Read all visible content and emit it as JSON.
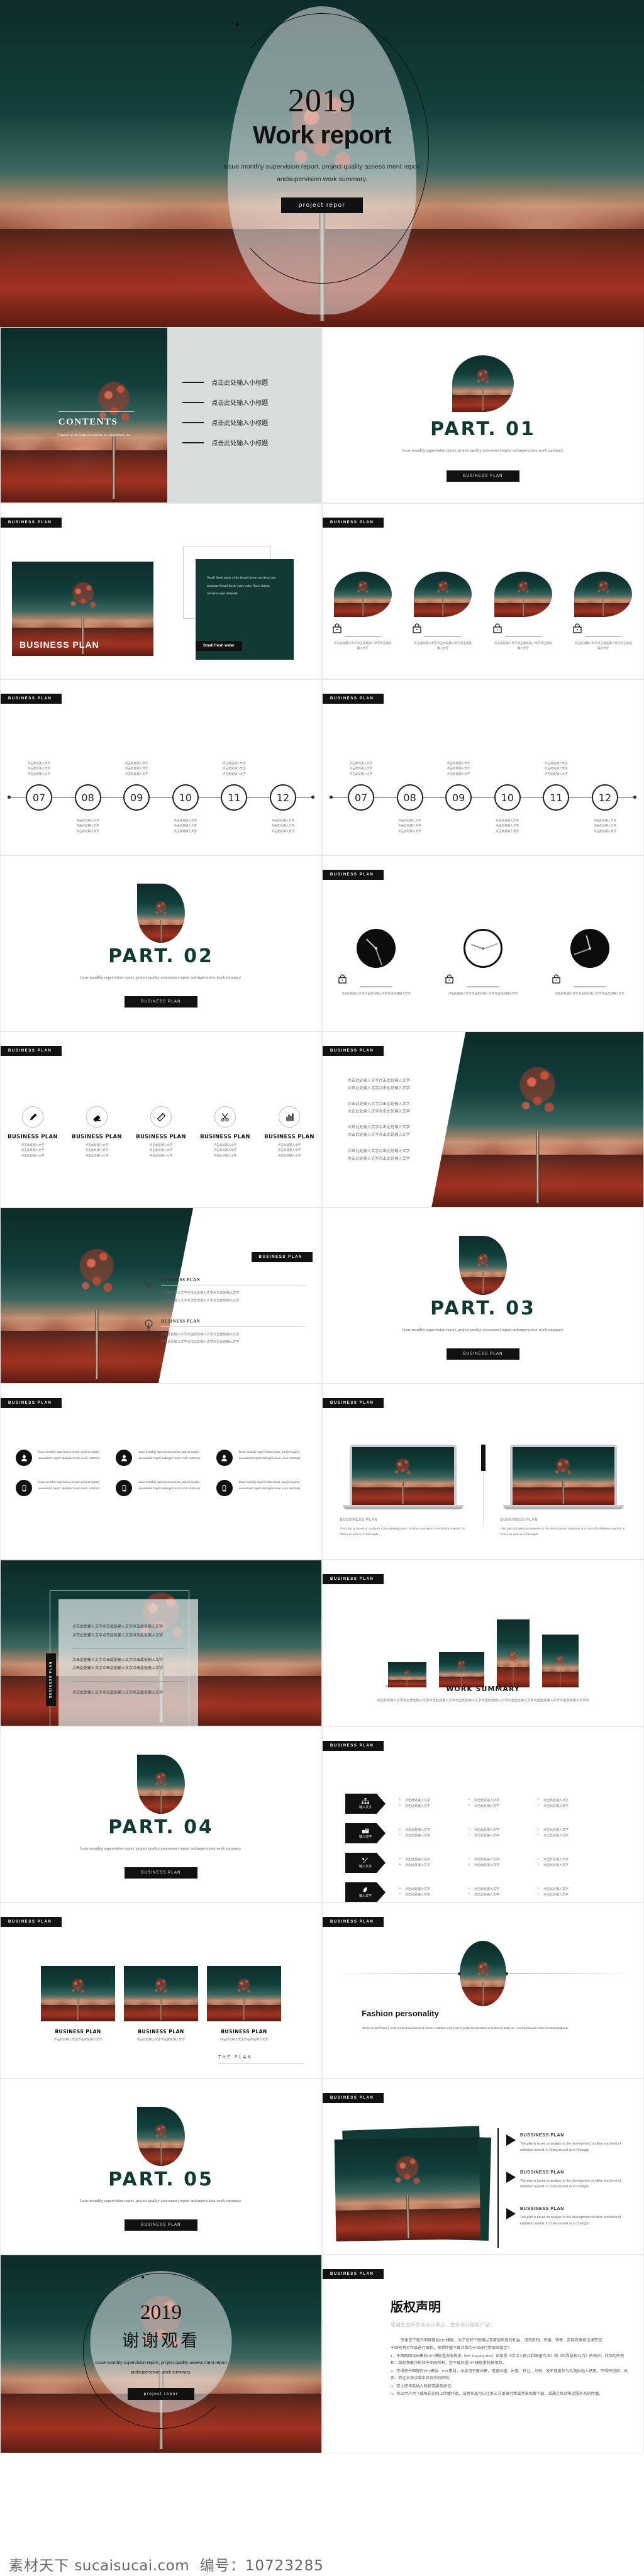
{
  "cover": {
    "year": "2019",
    "title": "Work report",
    "subtitle": "Issue monthly supervision report, project quality assess ment report andsupervision work summary.",
    "button": "project repor"
  },
  "tag": {
    "business_plan": "BUSINESS PLAN",
    "bussiness_plan": "BUSSINESS PLAN"
  },
  "contents": {
    "heading": "CONTENTS",
    "subtitle": "Reports of the work of a society or learned body etc.",
    "items": [
      "点击此处输入小标题",
      "点击此处输入小标题",
      "点击此处输入小标题",
      "点击此处输入小标题"
    ]
  },
  "parts": [
    {
      "title": "PART. 01",
      "sub": "Issue monthly supervision report, project quality assessment report andsupervision work summary.",
      "button": "BUSINESS PLAN"
    },
    {
      "title": "PART. 02",
      "sub": "Issue monthly supervision report, project quality assessment report andsupervision work summary.",
      "button": "BUSINESS PLAN"
    },
    {
      "title": "PART. 03",
      "sub": "Issue monthly supervision report, project quality assessment report andsupervision work summary.",
      "button": "BUSINESS PLAN"
    },
    {
      "title": "PART. 04",
      "sub": "Issue monthly supervision report, project quality assessment report andsupervision work summary.",
      "button": "BUSINESS PLAN"
    },
    {
      "title": "PART. 05",
      "sub": "Issue monthly supervision report, project quality assessment report andsupervision work summary.",
      "button": "BUSINESS PLAN"
    }
  ],
  "business_card": {
    "image_caption": "BUSINESS PLAN",
    "body": "Small fresh water color floral theme universal ppt template.Small fresh water color floral theme universal ppt template",
    "button": "Small fresh water"
  },
  "leaf_cards": {
    "caption": "点击此处输入文字点击此处输入文字点击此处输入文字",
    "count": 4
  },
  "timeline": {
    "nodes": [
      "07",
      "08",
      "09",
      "10",
      "11",
      "12"
    ],
    "caption": "点击此处输入文字\n点击此处输入文字\n点击此处输入文字"
  },
  "clocks": {
    "caption": "点击此处输入文字点击此处输入文字点击此处输入文字",
    "items": [
      {
        "style": "dark",
        "hour": 225,
        "minute": 70
      },
      {
        "style": "light",
        "hour": 200,
        "minute": 340
      },
      {
        "style": "dark",
        "hour": 255,
        "minute": 160
      }
    ]
  },
  "tools": {
    "items": [
      {
        "icon": "pencil-icon",
        "title": "BUSINESS PLAN"
      },
      {
        "icon": "eraser-icon",
        "title": "BUSINESS PLAN"
      },
      {
        "icon": "ruler-icon",
        "title": "BUSINESS PLAN"
      },
      {
        "icon": "scissors-icon",
        "title": "BUSINESS PLAN"
      },
      {
        "icon": "bar-chart-icon",
        "title": "BUSINESS PLAN"
      }
    ],
    "caption": "点击此处输入文字\n点击此处输入文字\n点击此处输入文字"
  },
  "diagonal_text": {
    "line": "点击此处输入文字点击此处输入文字\n点击此处输入文字点击此处输入文字"
  },
  "bulbs": {
    "items": [
      {
        "title": "BUSINESS PLAN",
        "line1": "点击此处输入文字点击此处输入文字点击此处输入文字",
        "line2": "点击此处输入文字点击此处输入文字点击此处输入文字"
      },
      {
        "title": "BUSINESS PLAN",
        "line1": "点击此处输入文字点击此处输入文字点击此处输入文字",
        "line2": "点击此处输入文字点击此处输入文字点击此处输入文字"
      }
    ]
  },
  "six_cards": {
    "body": "Issue monthly supervision report, project quality assessment report andsupervision work summary.",
    "icons": [
      "user-icon",
      "user-icon",
      "user-icon",
      "phone-icon",
      "phone-icon",
      "phone-icon"
    ]
  },
  "laptops": {
    "label": "BUSSINESS PLAN",
    "body": "This plan is based on analysis to the development condition and trend of exhibition inworld, in China as well as in Chengdu"
  },
  "overlay": {
    "side_button": "BUSINESS PLAN",
    "lines": [
      "点击此处输入文字点击此处输入文字点击此处输入文字",
      "点击此处输入文字点击此处输入文字点击此处输入文字",
      "点击此处输入文字点击此处输入文字点击此处输入文字",
      "点击此处输入文字点击此处输入文字点击此处输入文字",
      "点击此处输入文字点击此处输入文字点击此处输入文字"
    ]
  },
  "devices": {
    "heading": "WORK SUMMARY",
    "body": "点击此处输入文字点击此处输入文字点击此处输入文字点击此处输入文字点击此处输入文字点击此处输入文字点击此处输入文字点击此处输入文字点"
  },
  "arrows": {
    "rows": [
      {
        "icon": "org-chart-icon",
        "label": "输入文字"
      },
      {
        "icon": "building-icon",
        "label": "输入文字"
      },
      {
        "icon": "tools-icon",
        "label": "输入文字"
      },
      {
        "icon": "leaf-icon",
        "label": "输入文字"
      }
    ],
    "bullet": "点击此处输入文字"
  },
  "cards3": {
    "items": [
      {
        "title": "BUSINESS PLAN",
        "text": "点击此处输入文字点击此处输入文字"
      },
      {
        "title": "BUSINESS PLAN",
        "text": "点击此处输入文字点击此处输入文字"
      },
      {
        "title": "BUSINESS PLAN",
        "text": "点击此处输入文字点击此处输入文字"
      }
    ],
    "footer": "THE PLAN"
  },
  "fashion": {
    "title": "Fashion personality",
    "body": "Ability to proficiently write professional business reports complete with project goals,interpretation of statistical analyses, conclusions and viable recommendations."
  },
  "stacked": {
    "items": [
      {
        "title": "BUSSINESS PLAN",
        "text": "This plan is based on analysis to the development condition and trend of exhibition inworld, in China as well as in Chengdu"
      },
      {
        "title": "BUSSINESS PLAN",
        "text": "This plan is based on analysis to the development condition and trend of exhibition inworld, in China as well as in Chengdu"
      },
      {
        "title": "BUSSINESS PLAN",
        "text": "This plan is based on analysis to the development condition and trend of exhibition inworld, in China as well as in Chengdu"
      }
    ]
  },
  "thanks": {
    "year": "2019",
    "title": "谢谢观看",
    "subtitle": "Issue monthly supervision report, project quality assess ment report andsupervision work summary.",
    "button": "project repor"
  },
  "copyright": {
    "title": "版权声明",
    "lead": "感谢您支持原创设计事业，支持设计版权产品！",
    "paragraphs": [
      "感谢您下载千图网原创PPT模板，为了您和千图网以及原创作者的利益，请勿复制、传播、销售，否则将承担法律责任！",
      "千图网将对作品进行维权，按照传播下载次数的十倍进行索取赔偿金！",
      "1、千图网网站出售的PPT模版是免版税类（RF: Royalty-free）正版受《中华人民共和国著作法》和《世界版权公约》的保护，作品的所有权、版权和著作权归千图网所有，您下载的是PPT模版素材使用权。",
      "2、不得将千图网的PPT模版、PPT素材，本身用于再出售，或者出租、出借、转让、分销、发布或者作为礼物供他人使用，不得转授权、出卖、转让本协议或本协议中的权利。",
      "3、禁止把作品纳入商标或服务标记。",
      "4、禁止用户用下载格式在网上传播作品，或者作品可以让第三方单独付费或共享免费下载，或通过移动电话服务系统传播。"
    ]
  },
  "watermark": {
    "brand": "素材天下",
    "site": "sucaisucai.com",
    "id_label": "编号：",
    "id_value": "10723285"
  }
}
